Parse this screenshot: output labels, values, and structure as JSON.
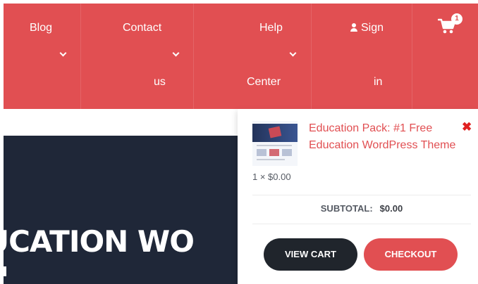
{
  "nav": {
    "blog": "Blog",
    "contact_line1": "Contact",
    "contact_line2": "us",
    "help_line1": "Help",
    "help_line2": "Center",
    "sign_line1": "Sign",
    "sign_line2": "in",
    "cart_count": "1"
  },
  "hero": {
    "title_visible": "UCATION WO"
  },
  "mini_cart": {
    "product_title": "Education Pack: #1 Free Education WordPress Theme",
    "remove": "✖",
    "quantity_line": "1 × $0.00",
    "subtotal_label": "SUBTOTAL:",
    "subtotal_value": "$0.00",
    "view_cart": "VIEW CART",
    "checkout": "CHECKOUT"
  },
  "colors": {
    "brand_red": "#e14f52",
    "hero_navy": "#1f2738",
    "button_dark": "#20252c"
  },
  "icons": {
    "cart": "cart-icon",
    "user": "user-icon",
    "dropdown": "chevron-down-icon",
    "remove": "close-icon"
  }
}
